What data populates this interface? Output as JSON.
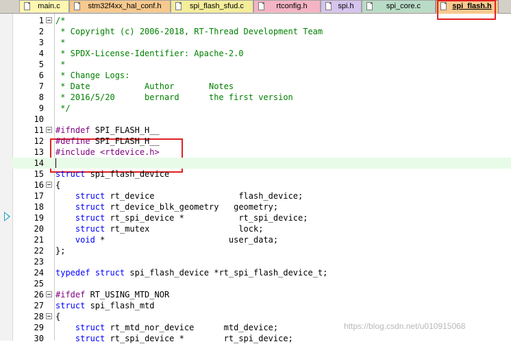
{
  "tabs": [
    {
      "label": "main.c",
      "color": "#fff6b0"
    },
    {
      "label": "stm32f4xx_hal_conf.h",
      "color": "#f7c98e"
    },
    {
      "label": "spi_flash_sfud.c",
      "color": "#f4ed9a"
    },
    {
      "label": "rtconfig.h",
      "color": "#f4b4c4"
    },
    {
      "label": "spi.h",
      "color": "#d6c4ee"
    },
    {
      "label": "spi_core.c",
      "color": "#b9dcc6"
    },
    {
      "label": "spi_flash.h",
      "color": "#f7c98e"
    }
  ],
  "active_tab": "spi_flash.h",
  "current_line": 14,
  "lines": [
    {
      "n": "1",
      "fold": true,
      "tokens": [
        {
          "c": "cmt",
          "t": "/*"
        }
      ]
    },
    {
      "n": "2",
      "fold": false,
      "tokens": [
        {
          "c": "cmt",
          "t": " * Copyright (c) 2006-2018, RT-Thread Development Team"
        }
      ]
    },
    {
      "n": "3",
      "fold": false,
      "tokens": [
        {
          "c": "cmt",
          "t": " *"
        }
      ]
    },
    {
      "n": "4",
      "fold": false,
      "tokens": [
        {
          "c": "cmt",
          "t": " * SPDX-License-Identifier: Apache-2.0"
        }
      ]
    },
    {
      "n": "5",
      "fold": false,
      "tokens": [
        {
          "c": "cmt",
          "t": " *"
        }
      ]
    },
    {
      "n": "6",
      "fold": false,
      "tokens": [
        {
          "c": "cmt",
          "t": " * Change Logs:"
        }
      ]
    },
    {
      "n": "7",
      "fold": false,
      "tokens": [
        {
          "c": "cmt",
          "t": " * Date           Author       Notes"
        }
      ]
    },
    {
      "n": "8",
      "fold": false,
      "tokens": [
        {
          "c": "cmt",
          "t": " * 2016/5/20      bernard      the first version"
        }
      ]
    },
    {
      "n": "9",
      "fold": false,
      "tokens": [
        {
          "c": "cmt",
          "t": " */"
        }
      ]
    },
    {
      "n": "10",
      "fold": false,
      "tokens": []
    },
    {
      "n": "11",
      "fold": true,
      "tokens": [
        {
          "c": "pp",
          "t": "#ifndef"
        },
        {
          "c": "txt",
          "t": " SPI_FLASH_H__"
        }
      ]
    },
    {
      "n": "12",
      "fold": false,
      "tokens": [
        {
          "c": "pp",
          "t": "#define"
        },
        {
          "c": "txt",
          "t": " SPI_FLASH_H__"
        }
      ]
    },
    {
      "n": "13",
      "fold": false,
      "tokens": [
        {
          "c": "pp",
          "t": "#include"
        },
        {
          "c": "txt",
          "t": " "
        },
        {
          "c": "str",
          "t": "<rtdevice.h>"
        }
      ]
    },
    {
      "n": "14",
      "fold": false,
      "tokens": []
    },
    {
      "n": "15",
      "fold": false,
      "tokens": [
        {
          "c": "kw",
          "t": "struct"
        },
        {
          "c": "txt",
          "t": " spi_flash_device"
        }
      ]
    },
    {
      "n": "16",
      "fold": true,
      "tokens": [
        {
          "c": "txt",
          "t": "{"
        }
      ]
    },
    {
      "n": "17",
      "fold": false,
      "tokens": [
        {
          "c": "txt",
          "t": "    "
        },
        {
          "c": "kw",
          "t": "struct"
        },
        {
          "c": "txt",
          "t": " rt_device                 flash_device;"
        }
      ]
    },
    {
      "n": "18",
      "fold": false,
      "tokens": [
        {
          "c": "txt",
          "t": "    "
        },
        {
          "c": "kw",
          "t": "struct"
        },
        {
          "c": "txt",
          "t": " rt_device_blk_geometry   geometry;"
        }
      ]
    },
    {
      "n": "19",
      "fold": false,
      "tokens": [
        {
          "c": "txt",
          "t": "    "
        },
        {
          "c": "kw",
          "t": "struct"
        },
        {
          "c": "txt",
          "t": " rt_spi_device *           rt_spi_device;"
        }
      ]
    },
    {
      "n": "20",
      "fold": false,
      "tokens": [
        {
          "c": "txt",
          "t": "    "
        },
        {
          "c": "kw",
          "t": "struct"
        },
        {
          "c": "txt",
          "t": " rt_mutex                  lock;"
        }
      ]
    },
    {
      "n": "21",
      "fold": false,
      "tokens": [
        {
          "c": "txt",
          "t": "    "
        },
        {
          "c": "kw",
          "t": "void"
        },
        {
          "c": "txt",
          "t": " *                         user_data;"
        }
      ]
    },
    {
      "n": "22",
      "fold": false,
      "tokens": [
        {
          "c": "txt",
          "t": "};"
        }
      ]
    },
    {
      "n": "23",
      "fold": false,
      "tokens": []
    },
    {
      "n": "24",
      "fold": false,
      "tokens": [
        {
          "c": "kw",
          "t": "typedef"
        },
        {
          "c": "txt",
          "t": " "
        },
        {
          "c": "kw",
          "t": "struct"
        },
        {
          "c": "txt",
          "t": " spi_flash_device *rt_spi_flash_device_t;"
        }
      ]
    },
    {
      "n": "25",
      "fold": false,
      "tokens": []
    },
    {
      "n": "26",
      "fold": true,
      "tokens": [
        {
          "c": "pp",
          "t": "#ifdef"
        },
        {
          "c": "txt",
          "t": " RT_USING_MTD_NOR"
        }
      ]
    },
    {
      "n": "27",
      "fold": false,
      "tokens": [
        {
          "c": "kw",
          "t": "struct"
        },
        {
          "c": "txt",
          "t": " spi_flash_mtd"
        }
      ]
    },
    {
      "n": "28",
      "fold": true,
      "tokens": [
        {
          "c": "txt",
          "t": "{"
        }
      ]
    },
    {
      "n": "29",
      "fold": false,
      "tokens": [
        {
          "c": "txt",
          "t": "    "
        },
        {
          "c": "kw",
          "t": "struct"
        },
        {
          "c": "txt",
          "t": " rt_mtd_nor_device      mtd_device;"
        }
      ]
    },
    {
      "n": "30",
      "fold": false,
      "tokens": [
        {
          "c": "txt",
          "t": "    "
        },
        {
          "c": "kw",
          "t": "struct"
        },
        {
          "c": "txt",
          "t": " rt_spi_device *        rt_spi_device;"
        }
      ]
    }
  ],
  "watermark": "https://blog.csdn.net/u010915068",
  "colors": {
    "comment": "#008000",
    "preprocessor": "#800080",
    "keyword": "#0000ff",
    "highlight_box": "#e02020",
    "current_line_bg": "#e8fbe8"
  }
}
